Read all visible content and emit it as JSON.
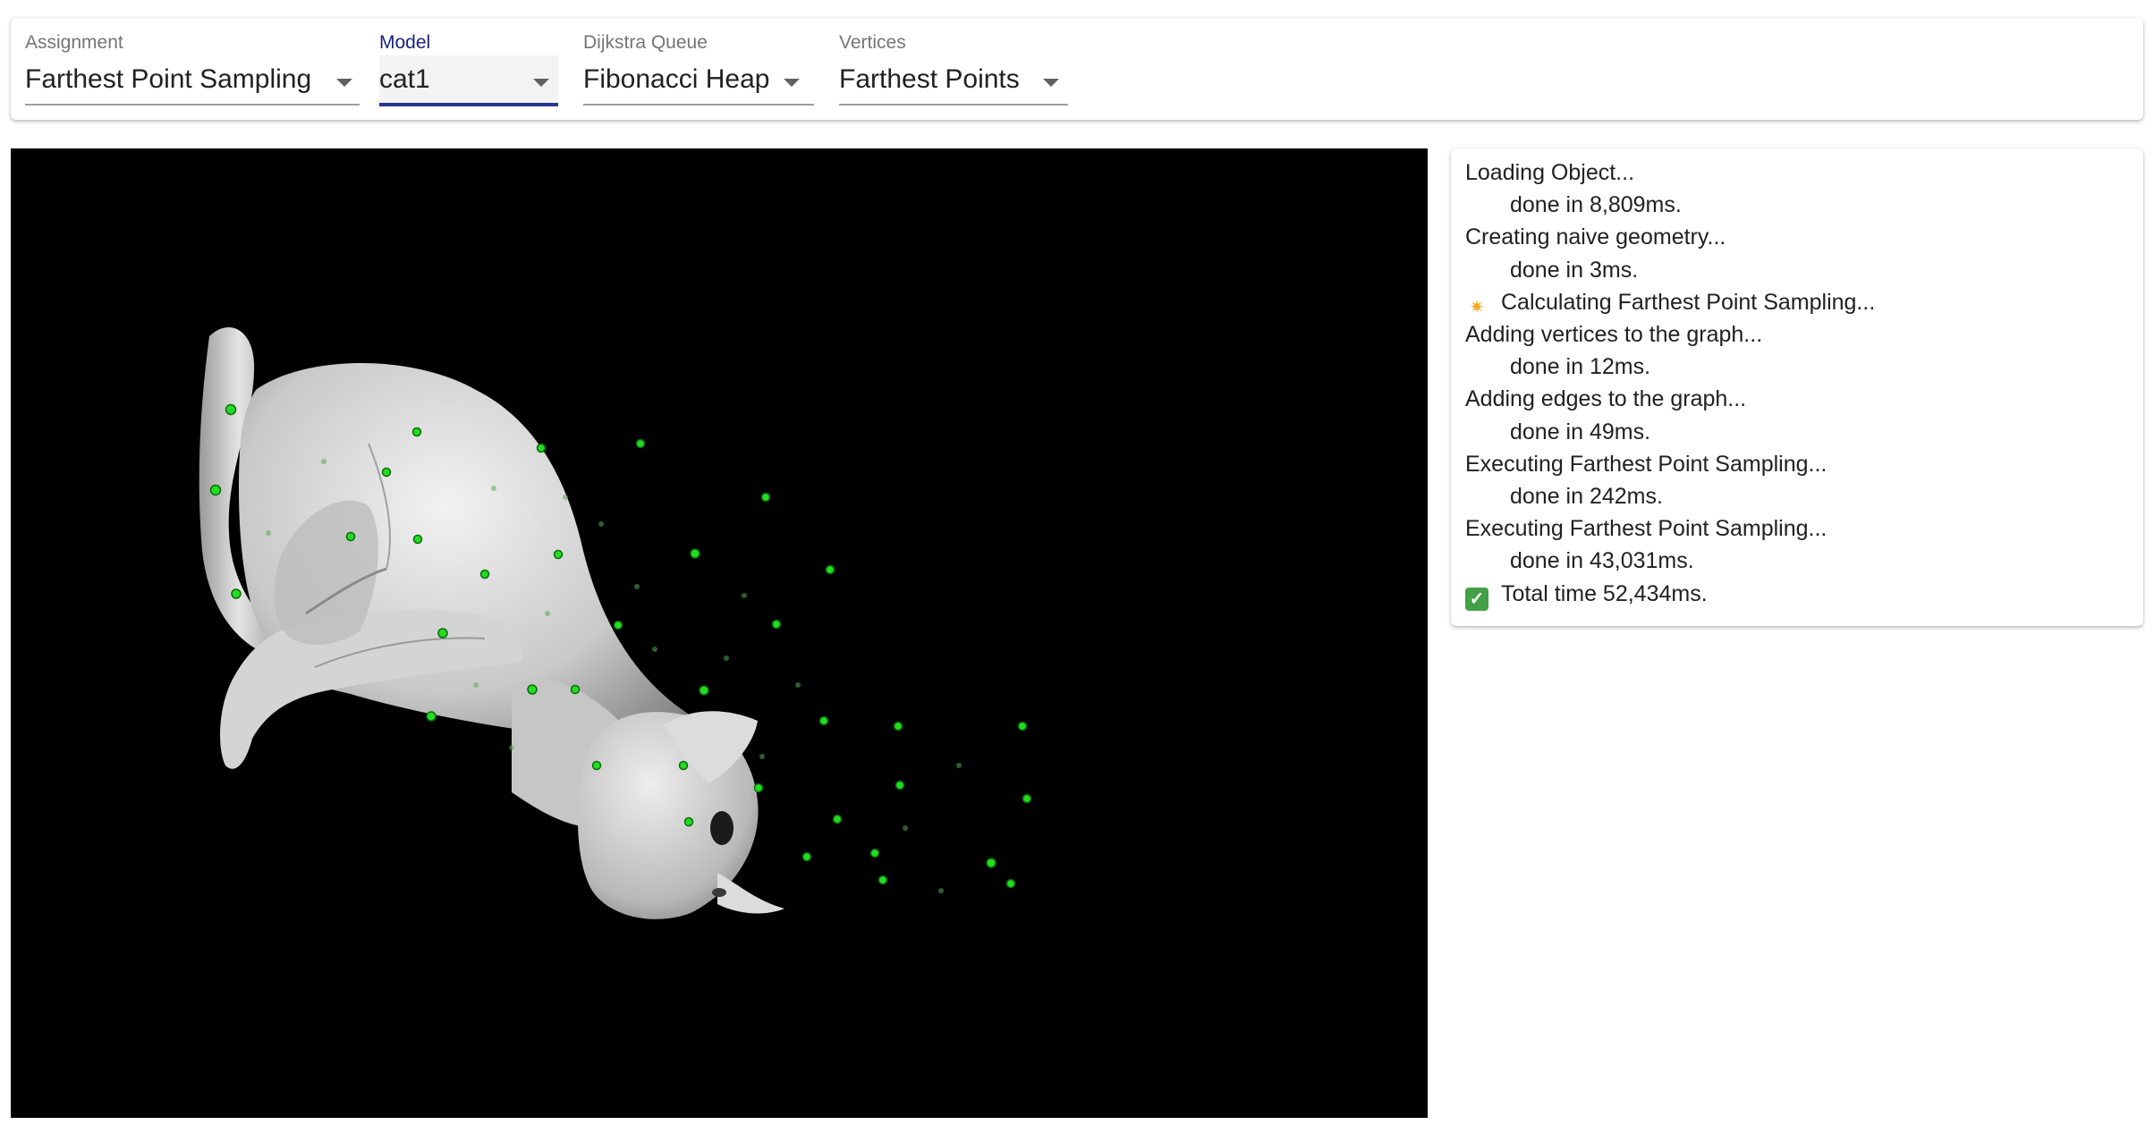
{
  "toolbar": {
    "assignment": {
      "label": "Assignment",
      "value": "Farthest Point Sampling"
    },
    "model": {
      "label": "Model",
      "value": "cat1"
    },
    "dijkstra_queue": {
      "label": "Dijkstra Queue",
      "value": "Fibonacci Heap"
    },
    "vertices": {
      "label": "Vertices",
      "value": "Farthest Points"
    }
  },
  "log": [
    {
      "text": "Loading Object...",
      "indent": false,
      "icon": null
    },
    {
      "text": "done in 8,809ms.",
      "indent": true,
      "icon": null
    },
    {
      "text": "Creating naive geometry...",
      "indent": false,
      "icon": null
    },
    {
      "text": "done in 3ms.",
      "indent": true,
      "icon": null
    },
    {
      "text": "Calculating Farthest Point Sampling...",
      "indent": false,
      "icon": "sparkle-icon"
    },
    {
      "text": "Adding vertices to the graph...",
      "indent": false,
      "icon": null
    },
    {
      "text": "done in 12ms.",
      "indent": true,
      "icon": null
    },
    {
      "text": "Adding edges to the graph...",
      "indent": false,
      "icon": null
    },
    {
      "text": "done in 49ms.",
      "indent": true,
      "icon": null
    },
    {
      "text": "Executing Farthest Point Sampling...",
      "indent": false,
      "icon": null
    },
    {
      "text": "done in 242ms.",
      "indent": true,
      "icon": null
    },
    {
      "text": "Executing Farthest Point Sampling...",
      "indent": false,
      "icon": null
    },
    {
      "text": "done in 43,031ms.",
      "indent": true,
      "icon": null
    },
    {
      "text": "Total time 52,434ms.",
      "indent": false,
      "icon": "check-icon"
    }
  ],
  "colors": {
    "accent": "#283593",
    "sample_point": "#22dd22",
    "mesh": "#c8c8c8",
    "viewport_bg": "#000000"
  }
}
